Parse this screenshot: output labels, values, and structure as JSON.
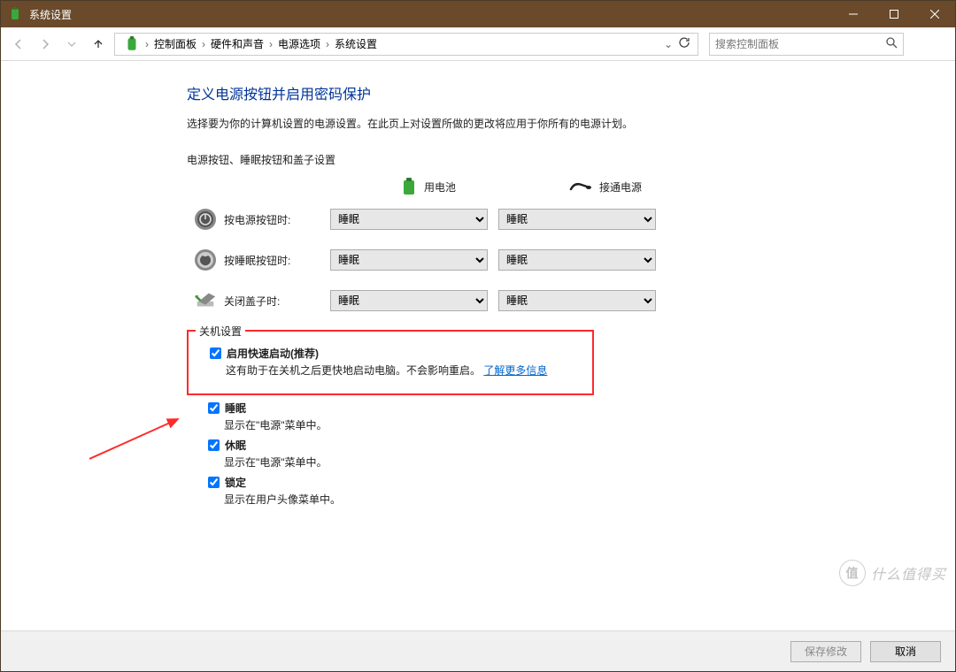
{
  "window": {
    "title": "系统设置"
  },
  "breadcrumb": {
    "items": [
      "控制面板",
      "硬件和声音",
      "电源选项",
      "系统设置"
    ]
  },
  "search": {
    "placeholder": "搜索控制面板"
  },
  "page": {
    "title": "定义电源按钮并启用密码保护",
    "desc": "选择要为你的计算机设置的电源设置。在此页上对设置所做的更改将应用于你所有的电源计划。",
    "section": "电源按钮、睡眠按钮和盖子设置",
    "col_battery": "用电池",
    "col_plugged": "接通电源"
  },
  "rows": [
    {
      "label": "按电源按钮时:",
      "battery": "睡眠",
      "plugged": "睡眠"
    },
    {
      "label": "按睡眠按钮时:",
      "battery": "睡眠",
      "plugged": "睡眠"
    },
    {
      "label": "关闭盖子时:",
      "battery": "睡眠",
      "plugged": "睡眠"
    }
  ],
  "shutdown": {
    "legend": "关机设置",
    "fast": {
      "label": "启用快速启动(推荐)",
      "desc_pre": "这有助于在关机之后更快地启动电脑。不会影响重启。",
      "link": "了解更多信息"
    },
    "sleep": {
      "label": "睡眠",
      "desc": "显示在\"电源\"菜单中。"
    },
    "hiber": {
      "label": "休眠",
      "desc": "显示在\"电源\"菜单中。"
    },
    "lock": {
      "label": "锁定",
      "desc": "显示在用户头像菜单中。"
    }
  },
  "footer": {
    "save": "保存修改",
    "cancel": "取消"
  },
  "watermark": {
    "badge": "值",
    "text": "什么值得买"
  }
}
